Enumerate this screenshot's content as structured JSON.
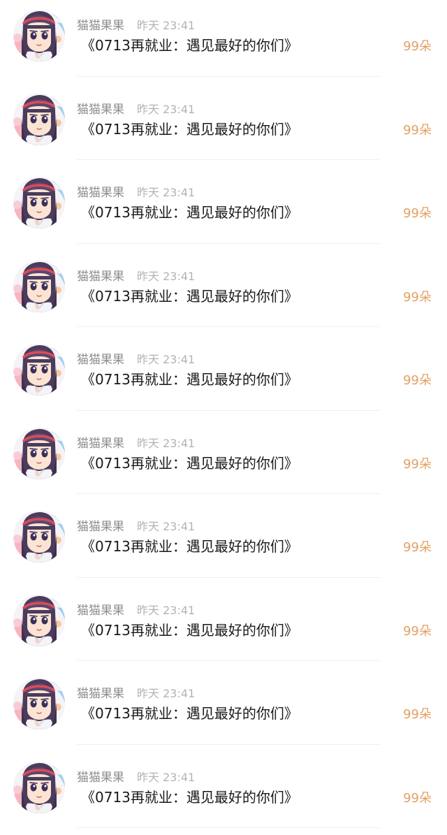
{
  "items": [
    {
      "user": "猫猫果果",
      "time": "昨天 23:41",
      "title": "《0713再就业：遇见最好的你们》",
      "gift": "99朵",
      "avatar_icon": "anime-girl-avatar"
    },
    {
      "user": "猫猫果果",
      "time": "昨天 23:41",
      "title": "《0713再就业：遇见最好的你们》",
      "gift": "99朵",
      "avatar_icon": "anime-girl-avatar"
    },
    {
      "user": "猫猫果果",
      "time": "昨天 23:41",
      "title": "《0713再就业：遇见最好的你们》",
      "gift": "99朵",
      "avatar_icon": "anime-girl-avatar"
    },
    {
      "user": "猫猫果果",
      "time": "昨天 23:41",
      "title": "《0713再就业：遇见最好的你们》",
      "gift": "99朵",
      "avatar_icon": "anime-girl-avatar"
    },
    {
      "user": "猫猫果果",
      "time": "昨天 23:41",
      "title": "《0713再就业：遇见最好的你们》",
      "gift": "99朵",
      "avatar_icon": "anime-girl-avatar"
    },
    {
      "user": "猫猫果果",
      "time": "昨天 23:41",
      "title": "《0713再就业：遇见最好的你们》",
      "gift": "99朵",
      "avatar_icon": "anime-girl-avatar"
    },
    {
      "user": "猫猫果果",
      "time": "昨天 23:41",
      "title": "《0713再就业：遇见最好的你们》",
      "gift": "99朵",
      "avatar_icon": "anime-girl-avatar"
    },
    {
      "user": "猫猫果果",
      "time": "昨天 23:41",
      "title": "《0713再就业：遇见最好的你们》",
      "gift": "99朵",
      "avatar_icon": "anime-girl-avatar"
    },
    {
      "user": "猫猫果果",
      "time": "昨天 23:41",
      "title": "《0713再就业：遇见最好的你们》",
      "gift": "99朵",
      "avatar_icon": "anime-girl-avatar"
    },
    {
      "user": "猫猫果果",
      "time": "昨天 23:41",
      "title": "《0713再就业：遇见最好的你们》",
      "gift": "99朵",
      "avatar_icon": "anime-girl-avatar"
    }
  ],
  "colors": {
    "background": "#ffffff",
    "username": "#8d8d8d",
    "timestamp": "#b3b3b3",
    "title": "#1a1a1a",
    "gift_accent": "#e4a063",
    "divider": "#efefef"
  }
}
